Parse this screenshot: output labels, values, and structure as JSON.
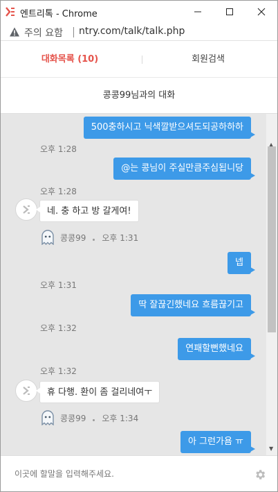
{
  "window": {
    "title": "엔트리톡 - Chrome",
    "min_icon": "minimize-icon",
    "max_icon": "maximize-icon",
    "close_icon": "close-icon"
  },
  "address_bar": {
    "warning": "주의 요함",
    "url": "ntry.com/talk/talk.php"
  },
  "tabs": [
    {
      "label": "대화목록 (10)",
      "active": true
    },
    {
      "label": "회원검색",
      "active": false
    }
  ],
  "conversation_title": "콩콩99님과의 대화",
  "messages": [
    {
      "from": "me",
      "text": "500충하시고 닉색깔받으셔도되공하하하",
      "time": ""
    },
    {
      "from": "me",
      "text": "@는 콩님이 주실만큼주심됩니당",
      "time": "오후 1:28"
    },
    {
      "from": "me",
      "text": "",
      "time": "오후 1:28"
    },
    {
      "from": "other",
      "text": "네. 충 하고 방 갈게여!",
      "name": "콩콩99",
      "time": "오후 1:31"
    },
    {
      "from": "me",
      "text": "넵",
      "time": "오후 1:31"
    },
    {
      "from": "me",
      "text": "딱 잘끊긴했네요 흐름끊기고",
      "time": "오후 1:32"
    },
    {
      "from": "me",
      "text": "연패할뻔했네요",
      "time": "오후 1:32"
    },
    {
      "from": "other",
      "text": "휴 다행. 환이 좀 걸리네여ㅜ",
      "name": "콩콩99",
      "time": "오후 1:34"
    },
    {
      "from": "me",
      "text": "아 그런가욤 ㅠ",
      "time": ""
    }
  ],
  "input": {
    "placeholder": "이곳에 할말을 입력해주세요."
  },
  "colors": {
    "accent_red": "#e5534b",
    "bubble_blue": "#3d9ae8",
    "chat_bg": "#e6e6e6"
  }
}
